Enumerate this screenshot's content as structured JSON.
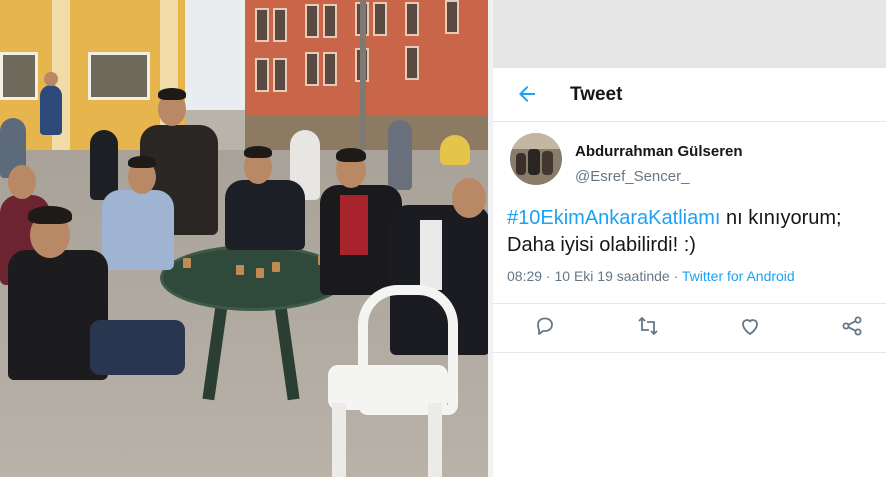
{
  "header": {
    "title": "Tweet"
  },
  "tweet": {
    "display_name": "Abdurrahman Gülseren",
    "handle": "@Esref_Sencer_",
    "hashtag": "#10EkimAnkaraKatliamı",
    "text_line1_rest": " nı kınıyorum;",
    "text_line2": "Daha iyisi olabilirdi! :)",
    "time": "08:29",
    "date_prefix": " · 10 Eki 19 saatinde · ",
    "source": "Twitter for Android"
  },
  "icons": {
    "back": "arrow-left-icon",
    "reply": "reply-icon",
    "retweet": "retweet-icon",
    "like": "heart-icon",
    "share": "share-icon"
  },
  "colors": {
    "accent": "#1da1f2",
    "text": "#14171a",
    "secondary": "#657786",
    "icon": "#657786"
  }
}
